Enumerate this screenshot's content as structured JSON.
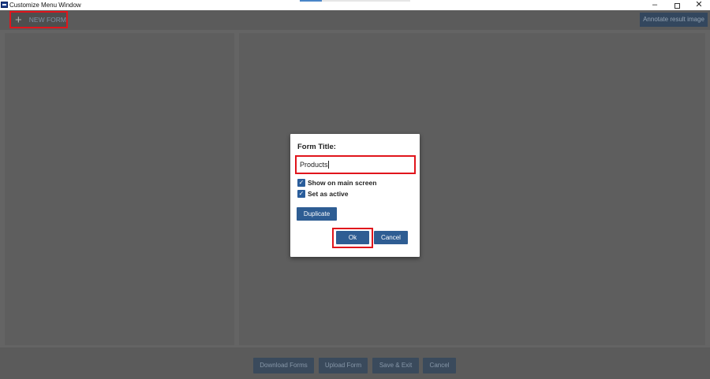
{
  "window": {
    "title": "Customize Menu Window",
    "controls": {
      "minimize": "–",
      "close": "✕"
    }
  },
  "toolbar": {
    "new_form_label": "NEW FORM",
    "new_form_icon": "+",
    "annotate_label": "Annotate result image"
  },
  "dialog": {
    "title_label": "Form Title:",
    "title_value": "Products",
    "show_on_main_label": "Show on main screen",
    "show_on_main_checked": true,
    "set_active_label": "Set as active",
    "set_active_checked": true,
    "check_glyph": "✓",
    "duplicate_label": "Duplicate",
    "ok_label": "Ok",
    "cancel_label": "Cancel"
  },
  "bottom": {
    "download_label": "Download Forms",
    "upload_label": "Upload Form",
    "save_exit_label": "Save & Exit",
    "cancel_label": "Cancel"
  },
  "colors": {
    "highlight": "#e0151c",
    "button_blue": "#2e5d93",
    "background_overlay": "#646464"
  }
}
